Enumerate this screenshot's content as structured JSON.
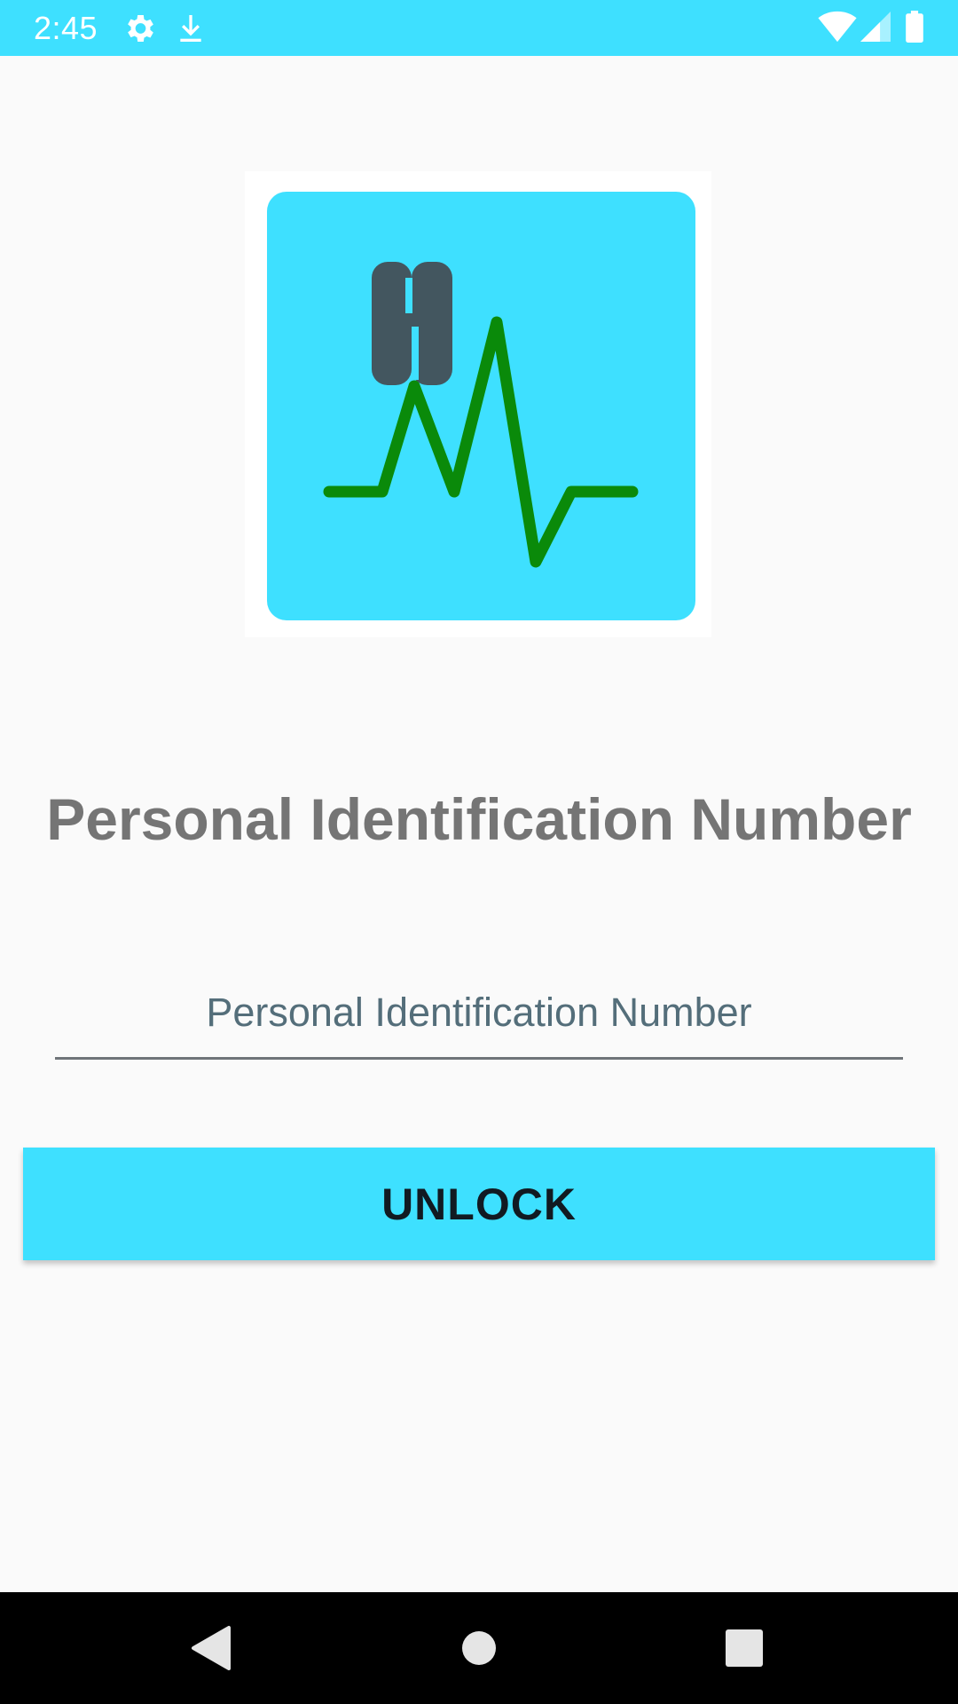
{
  "colors": {
    "accent": "#3ee0ff",
    "heading": "#757575",
    "placeholder": "#546e7a",
    "button_text": "#111a22",
    "logo_pulse": "#0a8a0a",
    "logo_letter": "#43565f"
  },
  "status_bar": {
    "time": "2:45",
    "left_icons": [
      "settings-gear-icon",
      "download-icon"
    ],
    "right_icons": [
      "wifi-icon",
      "cell-signal-icon",
      "battery-icon"
    ]
  },
  "logo": {
    "icon": "heart-monitor-logo-icon",
    "letter": "H"
  },
  "main": {
    "title": "Personal Identification Number",
    "pin_input": {
      "value": "",
      "placeholder": "Personal Identification Number"
    },
    "unlock_label": "UNLOCK"
  },
  "nav_bar": {
    "buttons": [
      "back-icon",
      "home-icon",
      "recents-icon"
    ]
  }
}
